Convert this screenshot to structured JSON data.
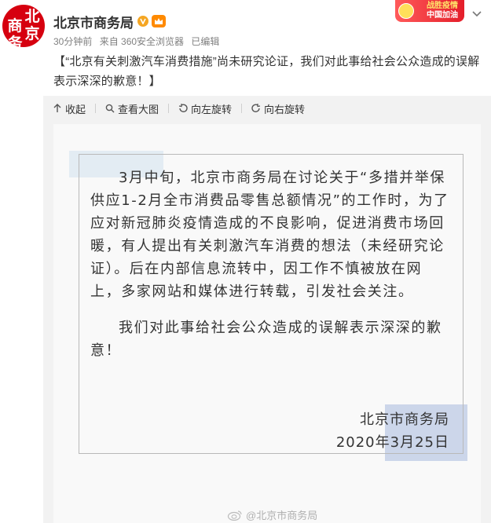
{
  "account": {
    "name": "北京市商务局",
    "avatar_text": [
      "北",
      "京",
      "商",
      "务"
    ],
    "verified_icon": "verified-v-icon",
    "member_icon": "vip-crown-icon"
  },
  "meta": {
    "time": "30分钟前",
    "source": "来自 360安全浏览器",
    "edited": "已编辑"
  },
  "badge": {
    "line1": "战胜疫情",
    "line2": "中国加油"
  },
  "post": {
    "text": "【“北京有关刺激汽车消费措施”尚未研究论证，我们对此事给社会公众造成的误解表示深深的歉意！】"
  },
  "toolbar": {
    "collapse": "收起",
    "view_large": "查看大图",
    "rotate_left": "向左旋转",
    "rotate_right": "向右旋转"
  },
  "notice": {
    "paragraph1": "3月中旬，北京市商务局在讨论关于“多措并举保供应1-2月全市消费品零售总额情况”的工作时，为了应对新冠肺炎疫情造成的不良影响，促进消费市场回暖，有人提出有关刺激汽车消费的想法（未经研究论证）。后在内部信息流转中，因工作不慎被放在网上，多家网站和媒体进行转载，引发社会关注。",
    "paragraph2": "我们对此事给社会公众造成的误解表示深深的歉意！",
    "signature": "北京市商务局",
    "date": "2020年3月25日",
    "watermark": "@北京市商务局"
  },
  "colors": {
    "avatar_red": "#d6000f",
    "toolbar_bg": "#f2f2f2",
    "badge_red": "#e41e2a"
  }
}
